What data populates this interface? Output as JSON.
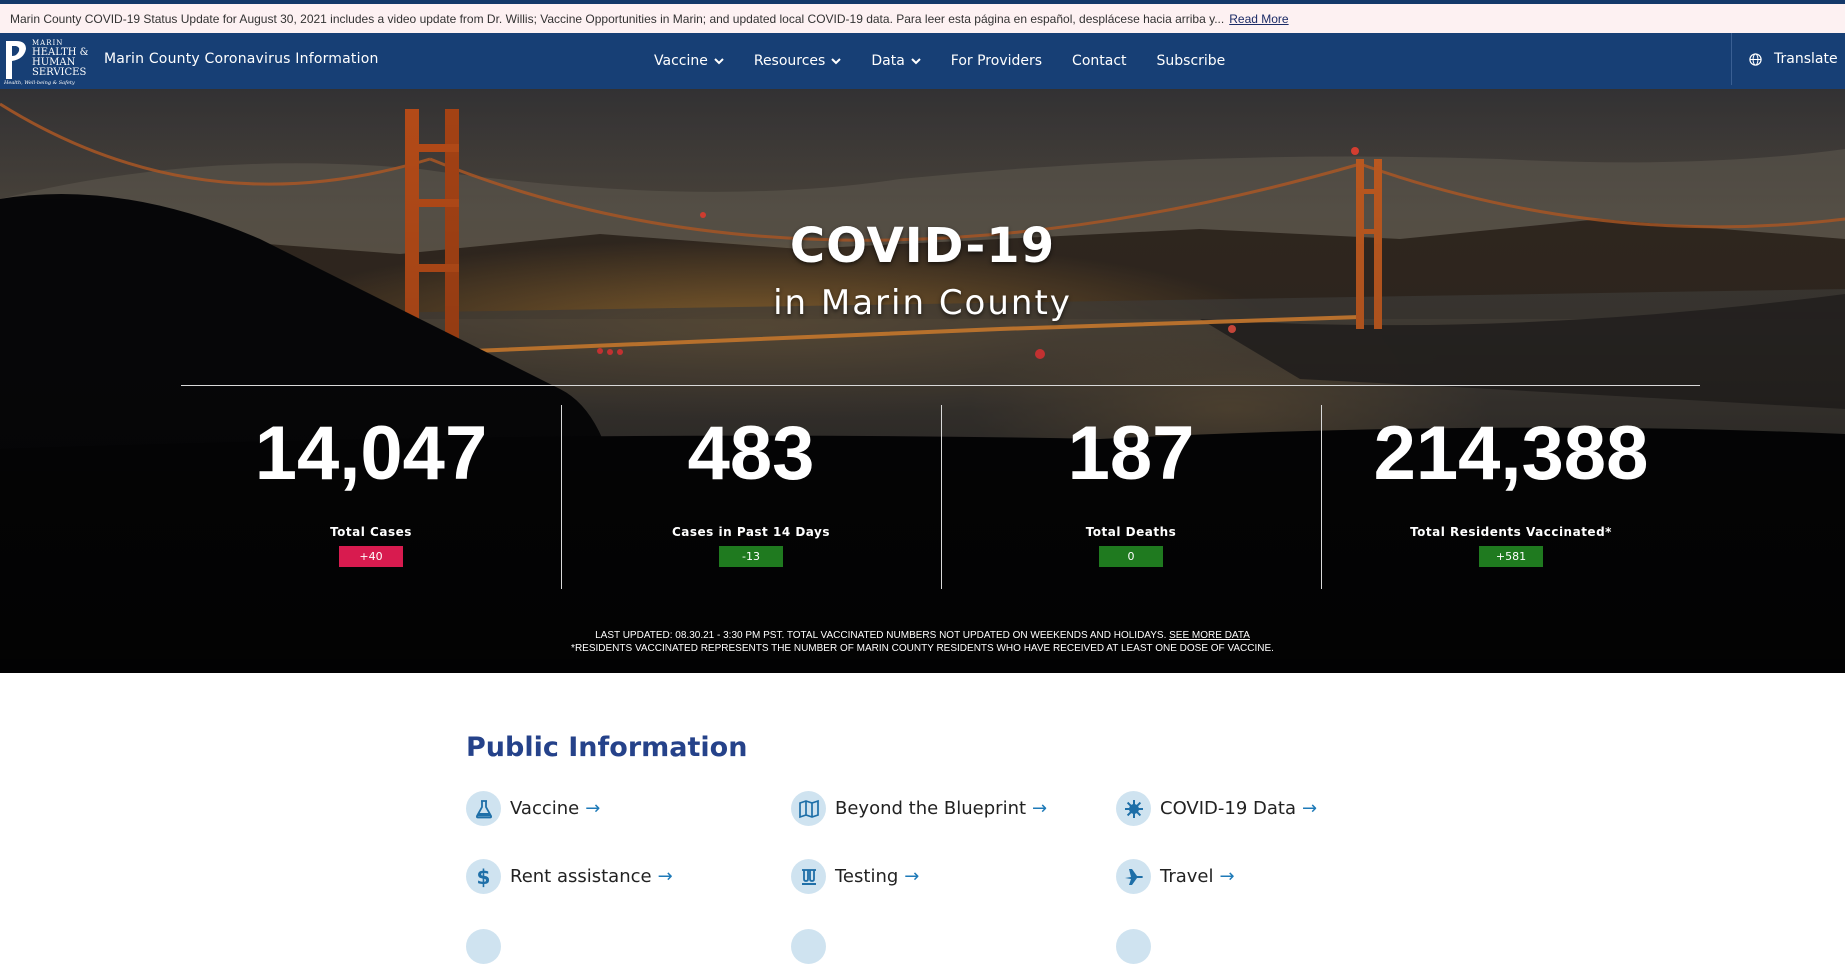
{
  "alert": {
    "text": "Marin County COVID-19 Status Update for August 30, 2021 includes a video update from Dr. Willis; Vaccine Opportunities in Marin; and updated local COVID-19 data. Para leer esta página en español, desplácese hacia arriba y...",
    "link": "Read More"
  },
  "nav": {
    "logo_lines": [
      "MARIN",
      "HEALTH &",
      "HUMAN",
      "SERVICES",
      "Health, Well-being & Safety"
    ],
    "site_title": "Marin County Coronavirus Information",
    "menu": [
      {
        "label": "Vaccine",
        "dropdown": true
      },
      {
        "label": "Resources",
        "dropdown": true
      },
      {
        "label": "Data",
        "dropdown": true
      },
      {
        "label": "For Providers",
        "dropdown": false
      },
      {
        "label": "Contact",
        "dropdown": false
      },
      {
        "label": "Subscribe",
        "dropdown": false
      }
    ],
    "translate": "Translate"
  },
  "hero": {
    "title": "COVID-19",
    "subtitle": "in Marin County",
    "stats": [
      {
        "value": "14,047",
        "label": "Total Cases",
        "change": "+40",
        "change_color": "#d81b4f"
      },
      {
        "value": "483",
        "label": "Cases in Past 14 Days",
        "change": "-13",
        "change_color": "#1f7a1f"
      },
      {
        "value": "187",
        "label": "Total Deaths",
        "change": "0",
        "change_color": "#1f7a1f"
      },
      {
        "value": "214,388",
        "label": "Total Residents Vaccinated*",
        "change": "+581",
        "change_color": "#1f7a1f"
      }
    ],
    "note1": "LAST UPDATED: 08.30.21 - 3:30 PM PST. TOTAL VACCINATED NUMBERS NOT UPDATED ON WEEKENDS AND HOLIDAYS.",
    "note1_link": "SEE MORE DATA",
    "note2": "*RESIDENTS VACCINATED REPRESENTS THE NUMBER OF MARIN COUNTY RESIDENTS WHO HAVE RECEIVED AT LEAST ONE DOSE OF VACCINE."
  },
  "public_info": {
    "title": "Public Information",
    "arrow": "→",
    "links": [
      {
        "label": "Vaccine",
        "icon": "flask-icon"
      },
      {
        "label": "Beyond the Blueprint",
        "icon": "map-icon"
      },
      {
        "label": "COVID-19 Data",
        "icon": "virus-icon"
      },
      {
        "label": "Rent assistance",
        "icon": "dollar-icon"
      },
      {
        "label": "Testing",
        "icon": "test-tubes-icon"
      },
      {
        "label": "Travel",
        "icon": "plane-icon"
      }
    ]
  },
  "colors": {
    "nav": "#173f75",
    "accent": "#25428a",
    "negative": "#d81b4f",
    "positive": "#1f7a1f"
  }
}
